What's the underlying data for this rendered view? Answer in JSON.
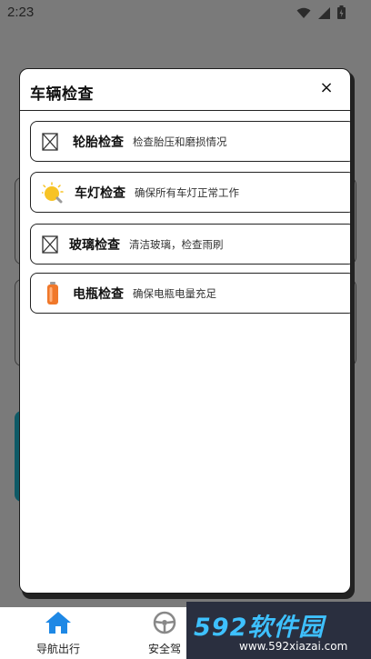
{
  "status_bar": {
    "time": "2:23",
    "icons": [
      "wifi-icon",
      "signal-icon",
      "battery-icon"
    ]
  },
  "dialog": {
    "title": "车辆检查",
    "close_label": "×",
    "items": [
      {
        "name": "轮胎检查",
        "desc": "检查胎压和磨损情况",
        "icon": "broken-image-icon"
      },
      {
        "name": "车灯检查",
        "desc": "确保所有车灯正常工作",
        "icon": "light-bulb-icon"
      },
      {
        "name": "玻璃检查",
        "desc": "清洁玻璃，检查雨刷",
        "icon": "broken-image-icon"
      },
      {
        "name": "电瓶检查",
        "desc": "确保电瓶电量充足",
        "icon": "battery-icon"
      }
    ]
  },
  "bottom_nav": {
    "items": [
      {
        "label": "导航出行",
        "icon": "home-icon"
      },
      {
        "label": "安全驾",
        "icon": "steering-wheel-icon"
      }
    ]
  },
  "watermark": {
    "brand": "592软件园",
    "url": "www.592xiazai.com"
  },
  "colors": {
    "overlay": "#7a7a7a",
    "nav_active": "#1e88e5",
    "brand": "#3ec1ff"
  }
}
